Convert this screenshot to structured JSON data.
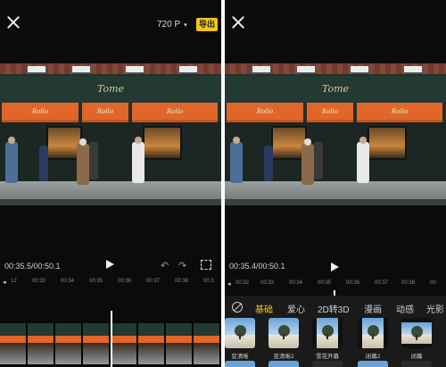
{
  "left": {
    "resolution": "720 P",
    "resolution_caret": "▾",
    "export_label": "导出",
    "sign_text": "Tome",
    "awning_text": "Rollo",
    "time": "00:35.5/00:50.1",
    "ruler_ticks": [
      "12",
      "00:33",
      "00:34",
      "00:35",
      "00:36",
      "00:37",
      "00:38",
      "00:3"
    ]
  },
  "right": {
    "sign_text": "Tome",
    "awning_text": "Rollo",
    "time": "00:35.4/00:50.1",
    "ruler_ticks": [
      "00:32",
      "00:33",
      "00:34",
      "00:35",
      "00:36",
      "00:37",
      "00:38",
      "00"
    ],
    "tabs": [
      "基础",
      "爱心",
      "2D转3D",
      "漫画",
      "动感",
      "光影"
    ],
    "active_tab": "基础",
    "effects": [
      "变清晰",
      "变清晰2",
      "雪花开幕",
      "闭幕2",
      "闭幕"
    ]
  },
  "icons": {
    "close": "close-icon",
    "play": "play-icon",
    "undo": "undo-icon",
    "redo": "redo-icon",
    "fullscreen": "fullscreen-icon",
    "none": "none-icon"
  },
  "colors": {
    "accent": "#f5c518",
    "awning": "#e0662a",
    "background": "#000000"
  }
}
